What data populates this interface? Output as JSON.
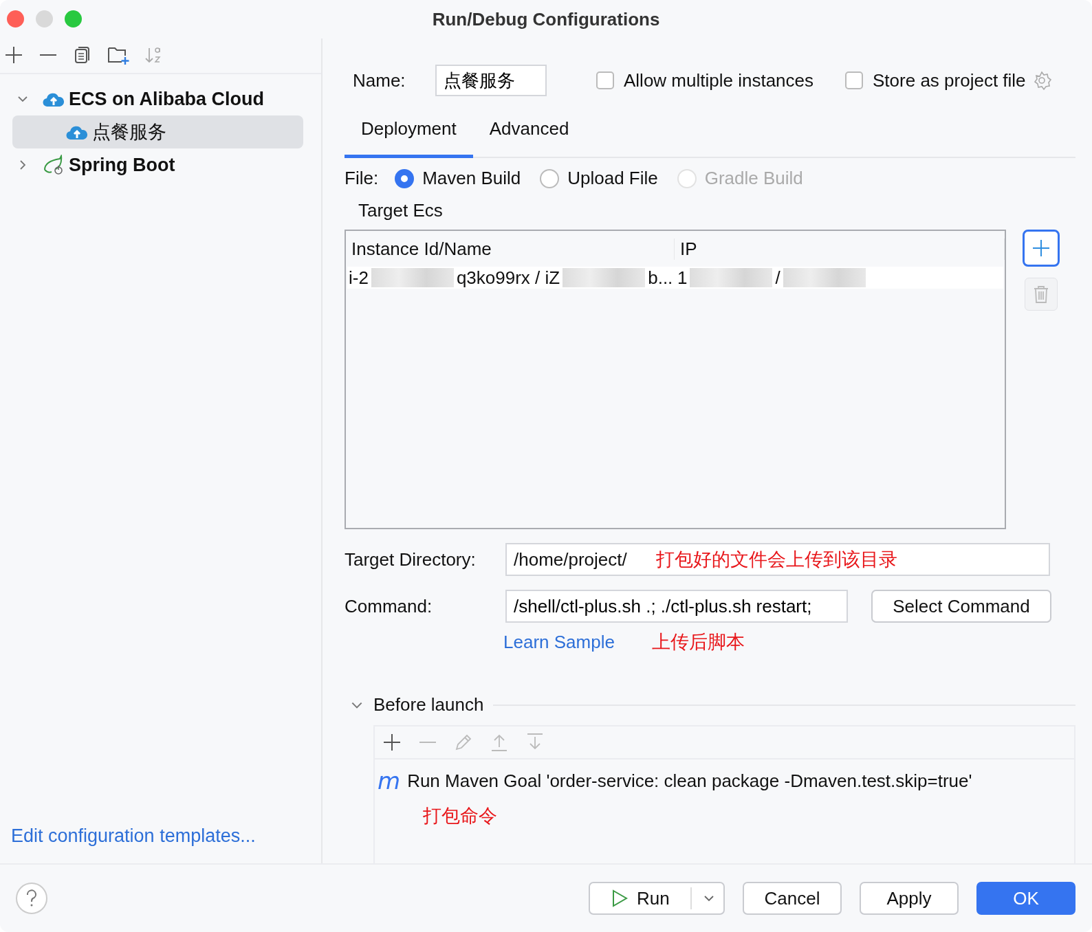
{
  "window": {
    "title": "Run/Debug Configurations"
  },
  "tree": [
    {
      "label": "ECS on Alibaba Cloud",
      "kind": "ecs",
      "expanded": true,
      "selected": false,
      "children": [
        {
          "label": "点餐服务",
          "kind": "ecs",
          "selected": true
        }
      ]
    },
    {
      "label": "Spring Boot",
      "kind": "spring",
      "expanded": false,
      "selected": false
    }
  ],
  "templates_link": "Edit configuration templates...",
  "name": {
    "label": "Name:",
    "value": "点餐服务"
  },
  "options": [
    {
      "label": "Allow multiple instances",
      "checked": false
    },
    {
      "label": "Store as project file",
      "checked": false
    }
  ],
  "tabs": [
    {
      "label": "Deployment",
      "selected": true
    },
    {
      "label": "Advanced",
      "selected": false
    }
  ],
  "file": {
    "label": "File:",
    "choices": [
      {
        "label": "Maven Build",
        "selected": true,
        "disabled": false
      },
      {
        "label": "Upload File",
        "selected": false,
        "disabled": false
      },
      {
        "label": "Gradle Build",
        "selected": false,
        "disabled": true
      }
    ]
  },
  "target_ecs": {
    "title": "Target Ecs",
    "columns": [
      "Instance Id/Name",
      "IP"
    ],
    "rows": [
      {
        "cells": [
          [
            {
              "kind": "text",
              "text": "i-2"
            },
            {
              "kind": "redacted"
            },
            {
              "kind": "text",
              "text": "q3ko99rx / iZ"
            },
            {
              "kind": "redacted"
            },
            {
              "kind": "text",
              "text": "b..."
            }
          ],
          [
            {
              "kind": "text",
              "text": "1"
            },
            {
              "kind": "redacted"
            },
            {
              "kind": "text",
              "text": "/"
            },
            {
              "kind": "redacted"
            }
          ]
        ]
      }
    ]
  },
  "target_directory": {
    "label": "Target Directory:",
    "value": "/home/project/",
    "annotation": "打包好的文件会上传到该目录"
  },
  "command": {
    "label": "Command:",
    "value": "/shell/ctl-plus.sh .; ./ctl-plus.sh restart;",
    "button": "Select Command",
    "link": "Learn Sample",
    "annotation": "上传后脚本"
  },
  "before_launch": {
    "title": "Before launch",
    "expanded": true,
    "tasks": [
      {
        "icon": "m",
        "text": "Run Maven Goal 'order-service: clean package -Dmaven.test.skip=true'"
      }
    ],
    "annotation": "打包命令"
  },
  "buttons": [
    {
      "label": "Run",
      "kind": "split"
    },
    {
      "label": "Cancel",
      "kind": "normal"
    },
    {
      "label": "Apply",
      "kind": "normal"
    },
    {
      "label": "OK",
      "kind": "primary"
    }
  ]
}
